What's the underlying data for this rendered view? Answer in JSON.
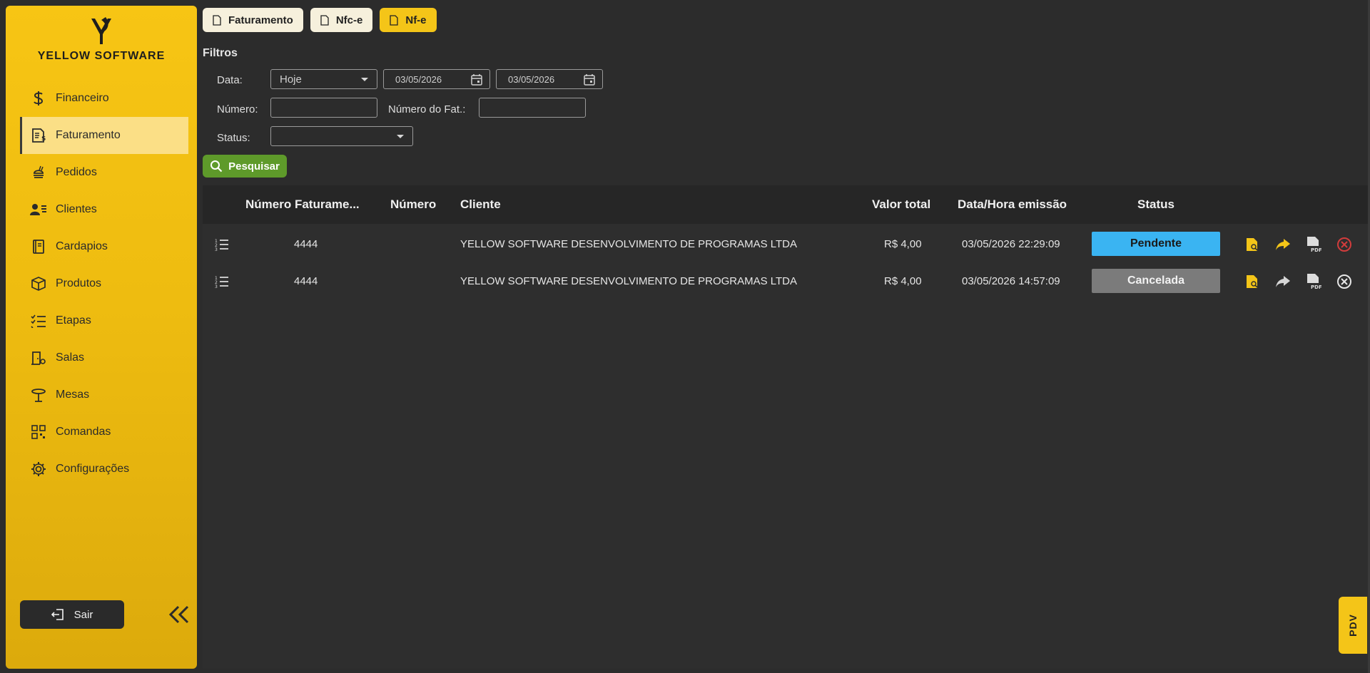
{
  "brand": {
    "name": "YELLOW SOFTWARE"
  },
  "sidebar": {
    "items": [
      {
        "label": "Financeiro",
        "icon": "dollar-icon"
      },
      {
        "label": "Faturamento",
        "icon": "invoice-icon",
        "active": true
      },
      {
        "label": "Pedidos",
        "icon": "food-icon"
      },
      {
        "label": "Clientes",
        "icon": "contact-card-icon"
      },
      {
        "label": "Cardapios",
        "icon": "menu-book-icon"
      },
      {
        "label": "Produtos",
        "icon": "box-icon"
      },
      {
        "label": "Etapas",
        "icon": "checklist-icon"
      },
      {
        "label": "Salas",
        "icon": "room-icon"
      },
      {
        "label": "Mesas",
        "icon": "table-icon"
      },
      {
        "label": "Comandas",
        "icon": "qr-code-icon"
      },
      {
        "label": "Configurações",
        "icon": "gear-icon"
      }
    ],
    "logout_label": "Sair"
  },
  "tabs": [
    {
      "label": "Faturamento"
    },
    {
      "label": "Nfc-e"
    },
    {
      "label": "Nf-e",
      "active": true
    }
  ],
  "filters": {
    "title": "Filtros",
    "data_label": "Data:",
    "data_value": "Hoje",
    "date_from": "03/05/2026",
    "date_to": "03/05/2026",
    "numero_label": "Número:",
    "numero_value": "",
    "numero_fat_label": "Número do Fat.:",
    "numero_fat_value": "",
    "status_label": "Status:",
    "status_value": "",
    "search_label": "Pesquisar"
  },
  "table": {
    "columns": [
      "Número Faturame...",
      "Número",
      "Cliente",
      "Valor total",
      "Data/Hora emissão",
      "Status"
    ],
    "rows": [
      {
        "numero_faturamento": "4444",
        "numero": "",
        "cliente": "YELLOW SOFTWARE DESENVOLVIMENTO DE PROGRAMAS LTDA",
        "valor_total": "R$ 4,00",
        "data_hora": "03/05/2026 22:29:09",
        "status": "Pendente",
        "status_color": "#3ab4f2"
      },
      {
        "numero_faturamento": "4444",
        "numero": "",
        "cliente": "YELLOW SOFTWARE DESENVOLVIMENTO DE PROGRAMAS LTDA",
        "valor_total": "R$ 4,00",
        "data_hora": "03/05/2026 14:57:09",
        "status": "Cancelada",
        "status_color": "#7b7b7b"
      }
    ]
  },
  "pdv_label": "PDV",
  "colors": {
    "accent": "#f4c518",
    "search": "#5e9a2a",
    "cancel_red": "#d23c3c"
  }
}
